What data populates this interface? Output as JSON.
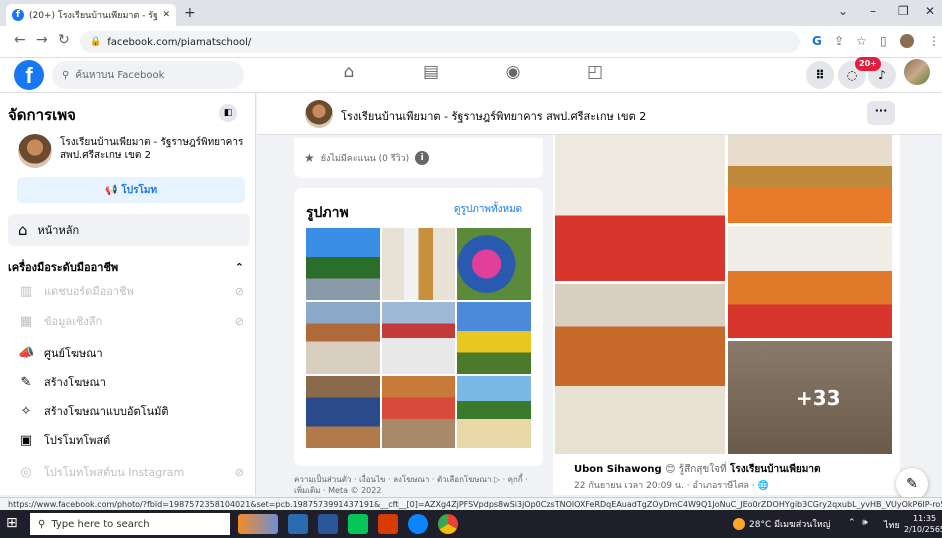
{
  "browser": {
    "tab_title": "(20+) โรงเรียนบ้านเพียมาต - รัฐราษฎ",
    "url": "facebook.com/piamatschool/"
  },
  "fb": {
    "search_placeholder": "ค้นหาบน Facebook",
    "notification_count": "20+"
  },
  "sidebar": {
    "title": "จัดการเพจ",
    "page_name": "โรงเรียนบ้านเพียมาต - รัฐราษฎร์พิทยาคาร สพป.ศรีสะเกษ เขต 2",
    "promote_label": "โปรโมท",
    "home_label": "หน้าหลัก",
    "tools_heading": "เครื่องมือระดับมืออาชีพ",
    "items": [
      {
        "label": "แดชบอร์ดมืออาชีพ",
        "icon": "dashboard-icon",
        "disabled": true
      },
      {
        "label": "ข้อมูลเชิงลึก",
        "icon": "insights-icon",
        "disabled": true
      },
      {
        "label": "ศูนย์โฆษณา",
        "icon": "megaphone-icon",
        "disabled": false
      },
      {
        "label": "สร้างโฆษณา",
        "icon": "pencil-icon",
        "disabled": false
      },
      {
        "label": "สร้างโฆษณาแบบอัตโนมัติ",
        "icon": "magic-wand-icon",
        "disabled": false
      },
      {
        "label": "โปรโมทโพสต์",
        "icon": "post-icon",
        "disabled": false
      },
      {
        "label": "โปรโมทโพสต์บน Instagram",
        "icon": "instagram-icon",
        "disabled": true
      }
    ]
  },
  "page_header": {
    "name": "โรงเรียนบ้านเพียมาต - รัฐราษฎร์พิทยาคาร สพป.ศรีสะเกษ เขต 2"
  },
  "rating": {
    "text": "ยังไม่มีคะแนน (0 รีวิว)"
  },
  "photos": {
    "title": "รูปภาพ",
    "see_all": "ดูรูปภาพทั้งหมด"
  },
  "footer": {
    "text": "ความเป็นส่วนตัว · เงื่อนไข · ลงโฆษณา · ตัวเลือกโฆษณา ▷ · คุกกี้ · เพิ่มเติม · Meta © 2022"
  },
  "post": {
    "more_count": "+33",
    "author": "Ubon Sihawong",
    "feeling": "😊 รู้สึกสุขใจที่",
    "page": "โรงเรียนบ้านเพียมาต",
    "time": "22 กันยายน เวลา 20:09 น. · อำเภอราษีไศล · 🌐"
  },
  "status_url": "https://www.facebook.com/photo/?fbid=1987572358104021&set=pcb.1987573991437191&__cft__[0]=AZXg4ZjPFSVpdps8wSi3jOp0CzsTNOlOXFeRDqEAuadTgZOyDmC4W9Q1JoNuC_JEo0rZDOHYgib3CGry2qxubL_yvHB_VUyOkP6IP-ro56lxDkyoqHN...",
  "taskbar": {
    "search_placeholder": "Type here to search",
    "weather": "28°C มีเมฆส่วนใหญ่",
    "lang": "ไทย",
    "time": "11:35",
    "date": "2/10/2565"
  }
}
